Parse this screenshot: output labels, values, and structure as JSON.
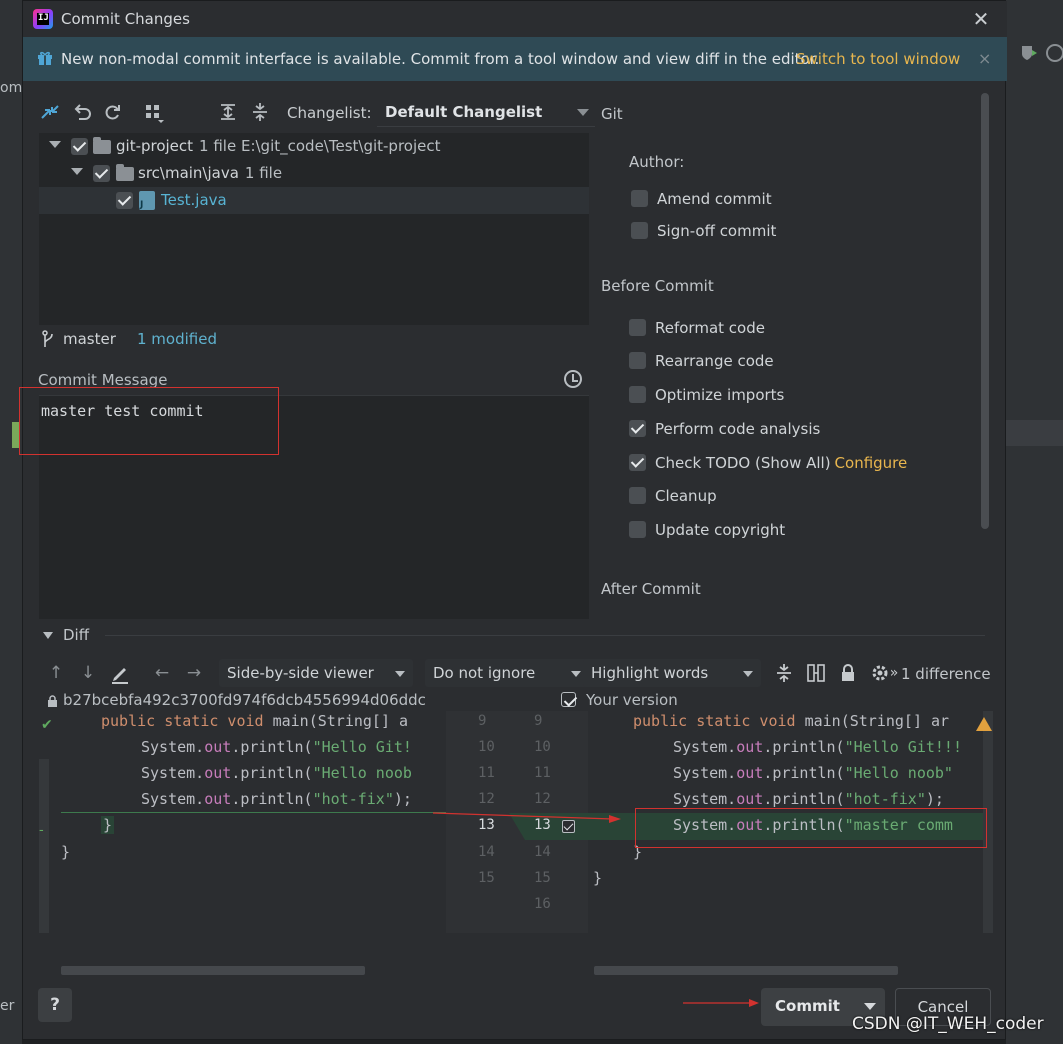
{
  "window": {
    "title": "Commit Changes"
  },
  "banner": {
    "text": "New non-modal commit interface is available. Commit from a tool window and view diff in the editor.",
    "link": "Switch to tool window",
    "close": "×"
  },
  "toolbar": {
    "changelist_label": "Changelist:",
    "changelist_value": "Default Changelist"
  },
  "tree": {
    "root": {
      "name": "git-project",
      "meta": "1 file  E:\\git_code\\Test\\git-project"
    },
    "folder": {
      "name": "src\\main\\java",
      "meta": "1 file"
    },
    "file": {
      "name": "Test.java"
    }
  },
  "branch": {
    "name": "master",
    "status": "1 modified"
  },
  "commit_message": {
    "label": "Commit Message",
    "text": "master test commit"
  },
  "git_options": {
    "header": "Git",
    "author_label": "Author:",
    "amend": "Amend commit",
    "signoff": "Sign-off commit"
  },
  "before_commit": {
    "header": "Before Commit",
    "items": [
      {
        "label": "Reformat code",
        "checked": false
      },
      {
        "label": "Rearrange code",
        "checked": false
      },
      {
        "label": "Optimize imports",
        "checked": false
      },
      {
        "label": "Perform code analysis",
        "checked": true
      },
      {
        "label": "Check TODO (Show All)",
        "checked": true,
        "link": "Configure"
      },
      {
        "label": "Cleanup",
        "checked": false
      },
      {
        "label": "Update copyright",
        "checked": false
      }
    ]
  },
  "after_commit": {
    "header": "After Commit"
  },
  "diff": {
    "title": "Diff",
    "viewer": "Side-by-side viewer",
    "whitespace": "Do not ignore",
    "highlight": "Highlight words",
    "count": "1 difference",
    "left_header": "b27bcebfa492c3700fd974f6dcb4556994d06ddc",
    "right_header": "Your version",
    "left_lines": [
      "9",
      "10",
      "11",
      "12",
      "13",
      "14",
      "15"
    ],
    "right_lines": [
      "9",
      "10",
      "11",
      "12",
      "13",
      "14",
      "15",
      "16"
    ],
    "left_code": [
      "public static void main(String[] a",
      "System.out.println(\"Hello Git!",
      "System.out.println(\"Hello noob",
      "System.out.println(\"hot-fix\");",
      "}",
      "}"
    ],
    "right_code": [
      "public static void main(String[] ar",
      "System.out.println(\"Hello Git!!!",
      "System.out.println(\"Hello noob\"",
      "System.out.println(\"hot-fix\");",
      "System.out.println(\"master comm",
      "}",
      "}"
    ]
  },
  "buttons": {
    "help": "?",
    "commit": "Commit",
    "cancel": "Cancel"
  },
  "watermark": "CSDN @IT_WEH_coder",
  "background": {
    "left_top": "om",
    "left_bottom": "er"
  },
  "colors": {
    "accent_link": "#e8b64e",
    "added_bg": "#294436",
    "annotation_red": "#d2322f"
  }
}
